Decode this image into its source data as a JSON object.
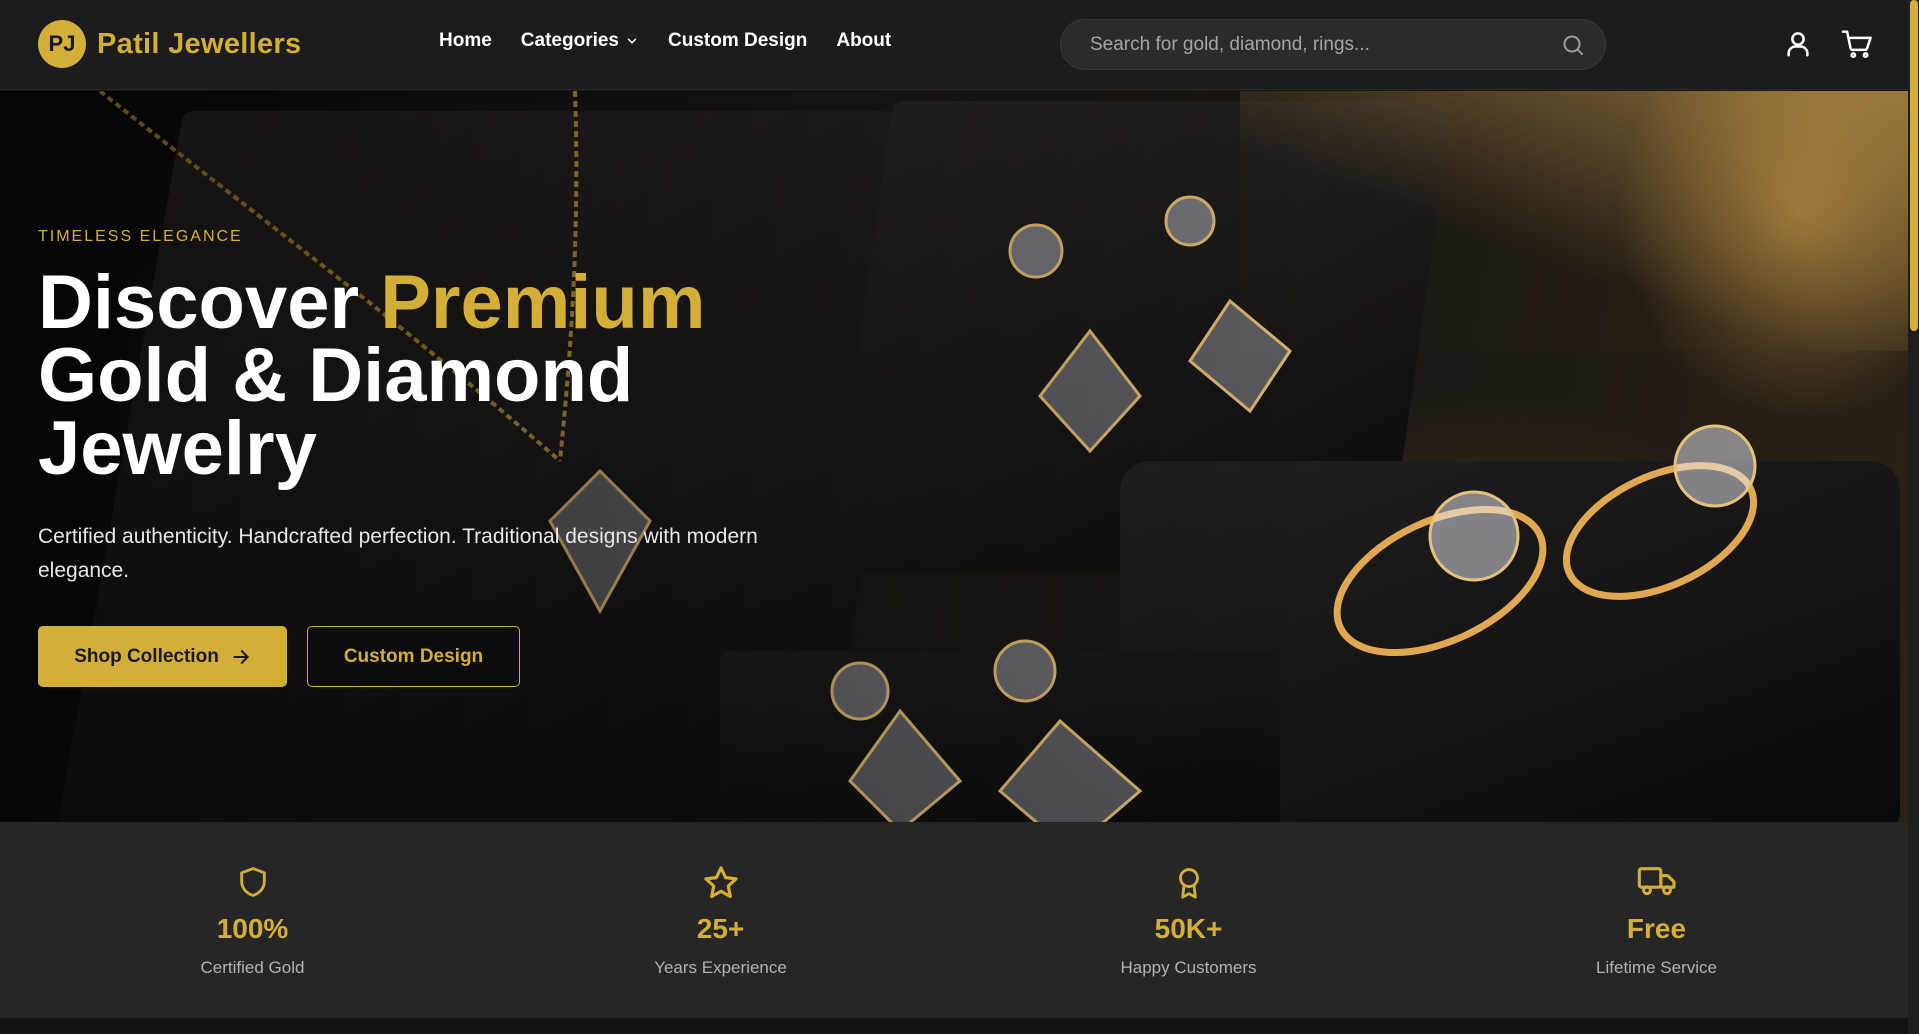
{
  "brand": {
    "initials": "PJ",
    "name": "Patil Jewellers"
  },
  "nav": {
    "items": [
      {
        "label": "Home"
      },
      {
        "label": "Categories"
      },
      {
        "label": "Custom Design"
      },
      {
        "label": "About"
      }
    ]
  },
  "search": {
    "placeholder": "Search for gold, diamond, rings..."
  },
  "hero": {
    "eyebrow": "TIMELESS ELEGANCE",
    "title_part1": "Discover ",
    "title_highlight": "Premium",
    "title_line2": "Gold & Diamond",
    "title_line3": "Jewelry",
    "subtitle": "Certified authenticity. Handcrafted perfection. Traditional designs with modern elegance.",
    "primary_button": "Shop Collection",
    "secondary_button": "Custom Design"
  },
  "stats": [
    {
      "icon": "shield-icon",
      "value": "100%",
      "label": "Certified Gold"
    },
    {
      "icon": "star-icon",
      "value": "25+",
      "label": "Years Experience"
    },
    {
      "icon": "award-icon",
      "value": "50K+",
      "label": "Happy Customers"
    },
    {
      "icon": "truck-icon",
      "value": "Free",
      "label": "Lifetime Service"
    }
  ],
  "colors": {
    "accent": "#d4af37",
    "header_bg": "#1c1c1c",
    "stats_bg": "#262626"
  }
}
